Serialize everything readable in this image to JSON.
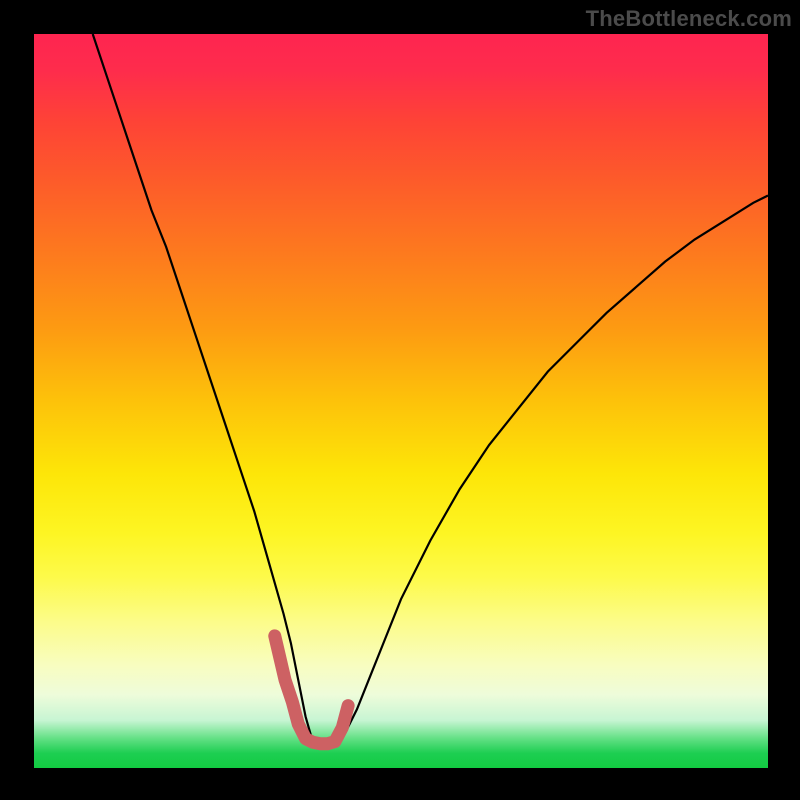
{
  "watermark": "TheBottleneck.com",
  "chart_data": {
    "type": "line",
    "title": "",
    "xlabel": "",
    "ylabel": "",
    "xlim": [
      0,
      100
    ],
    "ylim": [
      0,
      100
    ],
    "grid": false,
    "series": [
      {
        "name": "bottleneck-curve",
        "color": "#000000",
        "stroke_width": 2.2,
        "x": [
          8,
          10,
          12,
          14,
          16,
          18,
          20,
          22,
          24,
          26,
          28,
          30,
          32,
          34,
          35,
          36,
          37,
          38,
          39,
          40,
          42,
          44,
          46,
          48,
          50,
          54,
          58,
          62,
          66,
          70,
          74,
          78,
          82,
          86,
          90,
          94,
          98,
          100
        ],
        "y": [
          100,
          94,
          88,
          82,
          76,
          71,
          65,
          59,
          53,
          47,
          41,
          35,
          28,
          21,
          17,
          12,
          7,
          3.5,
          3,
          3,
          4,
          8,
          13,
          18,
          23,
          31,
          38,
          44,
          49,
          54,
          58,
          62,
          65.5,
          69,
          72,
          74.5,
          77,
          78
        ]
      },
      {
        "name": "highlight-segment",
        "color": "#cd6163",
        "stroke_width": 13,
        "linecap": "round",
        "x": [
          32.8,
          33.5,
          34.2,
          35.2,
          36.0,
          37.0,
          38.0,
          39.0,
          40.0,
          41.0,
          42.0,
          42.8
        ],
        "y": [
          18.0,
          15.0,
          12.0,
          9.0,
          6.0,
          4.0,
          3.5,
          3.3,
          3.3,
          3.6,
          5.5,
          8.5
        ]
      }
    ],
    "note": "Axes have no visible tick labels; values are normalized 0–100. Curve dips to ~3 near x≈38 then rises asymptotically toward ~78 at x=100."
  }
}
